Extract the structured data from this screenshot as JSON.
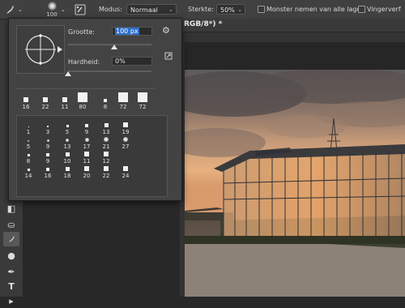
{
  "optbar": {
    "brush_size": "100",
    "mode_label": "Modus:",
    "mode_value": "Normaal",
    "strength_label": "Sterkte:",
    "strength_value": "50%",
    "sample_all_layers": "Monster nemen van alle lagen",
    "finger_paint": "Vingerverf"
  },
  "doc_tab": {
    "title": "RGB/8*) *"
  },
  "brush_panel": {
    "size_label": "Grootte:",
    "size_value": "100 px",
    "hardness_label": "Hardheid:",
    "hardness_value": "0%",
    "size_level_fraction": 0.1,
    "hardness_level_fraction": 0.0,
    "recent": [
      {
        "label": "16",
        "kind": "hard"
      },
      {
        "label": "22",
        "kind": "hard"
      },
      {
        "label": "11",
        "kind": "hard"
      },
      {
        "label": "80",
        "kind": "hard"
      },
      {
        "label": "8",
        "kind": "hard"
      },
      {
        "label": "72",
        "kind": "hard"
      },
      {
        "label": "72",
        "kind": "hard"
      }
    ],
    "presets": [
      {
        "label": "1"
      },
      {
        "label": "3"
      },
      {
        "label": "5"
      },
      {
        "label": "9"
      },
      {
        "label": "13"
      },
      {
        "label": "19"
      },
      {
        "label": "5"
      },
      {
        "label": "9"
      },
      {
        "label": "13"
      },
      {
        "label": "17"
      },
      {
        "label": "21"
      },
      {
        "label": "27"
      },
      {
        "label": "8"
      },
      {
        "label": "9"
      },
      {
        "label": "10"
      },
      {
        "label": "11"
      },
      {
        "label": "12"
      },
      {
        "label": "14"
      },
      {
        "label": "16"
      },
      {
        "label": "18"
      },
      {
        "label": "20"
      },
      {
        "label": "22"
      },
      {
        "label": "24"
      }
    ]
  },
  "colors": {
    "panel": "#434343",
    "optbar": "#404040",
    "highlight": "#2d6ec9",
    "sky_top": "#5e5a5c",
    "sky_glow": "#e7b17e"
  }
}
